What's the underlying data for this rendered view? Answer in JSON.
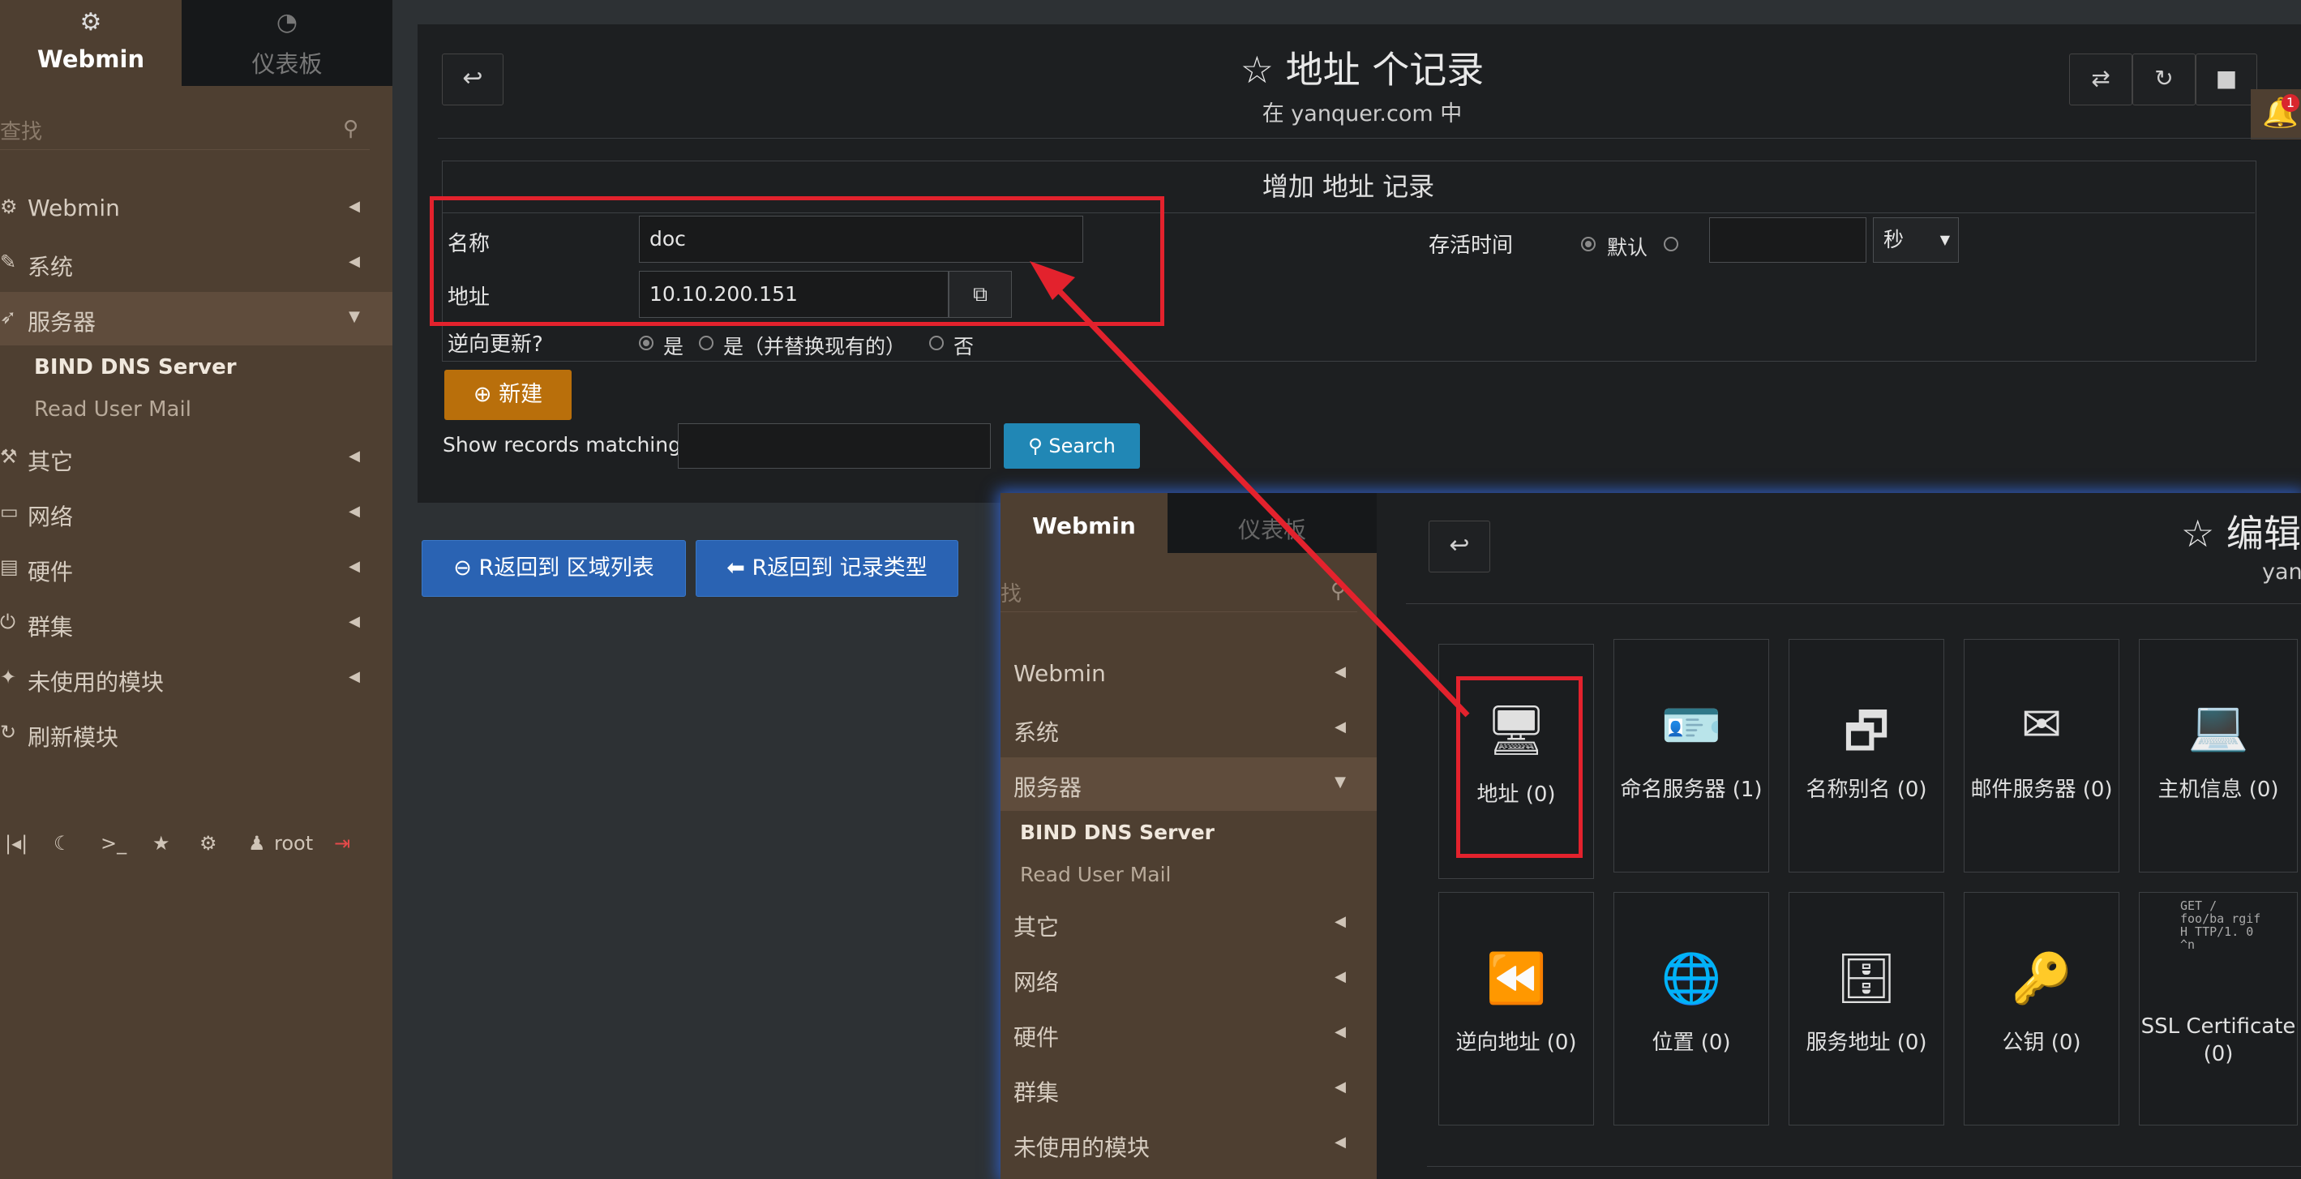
{
  "sidebar": {
    "tab_webmin": "Webmin",
    "tab_dashboard": "仪表板",
    "search_placeholder": "查找",
    "items": [
      {
        "label": "Webmin"
      },
      {
        "label": "系统"
      },
      {
        "label": "服务器"
      },
      {
        "label": "其它"
      },
      {
        "label": "网络"
      },
      {
        "label": "硬件"
      },
      {
        "label": "群集"
      },
      {
        "label": "未使用的模块"
      },
      {
        "label": "刷新模块"
      }
    ],
    "subitems": [
      {
        "label": "BIND DNS Server"
      },
      {
        "label": "Read User Mail"
      }
    ],
    "user": "root"
  },
  "header": {
    "title": "地址 个记录",
    "subtitle": "在 yanquer.com 中",
    "notification_count": "1"
  },
  "form": {
    "heading": "增加 地址 记录",
    "name_label": "名称",
    "name_value": "doc",
    "address_label": "地址",
    "address_value": "10.10.200.151",
    "ttl_label": "存活时间",
    "ttl_default": "默认",
    "ttl_unit": "秒",
    "reverse_label": "逆向更新?",
    "reverse_yes": "是",
    "reverse_replace": "是（并替换现有的）",
    "reverse_no": "否",
    "new_button": "新建",
    "show_matching_label": "Show records matching:",
    "search_button": "Search"
  },
  "back_buttons": {
    "zone_list": "R返回到 区域列表",
    "record_types": "R返回到 记录类型"
  },
  "overlay": {
    "tab_webmin": "Webmin",
    "tab_dashboard": "仪表板",
    "search_placeholder": "找",
    "items": [
      {
        "label": "Webmin"
      },
      {
        "label": "系统"
      },
      {
        "label": "服务器"
      },
      {
        "label": "其它"
      },
      {
        "label": "网络"
      },
      {
        "label": "硬件"
      },
      {
        "label": "群集"
      },
      {
        "label": "未使用的模块"
      }
    ],
    "subitems": [
      {
        "label": "BIND DNS Server"
      },
      {
        "label": "Read User Mail"
      }
    ],
    "title": "编辑",
    "subtitle": "yanq",
    "tiles": [
      {
        "label": "地址 (0)",
        "icon": "computer-icon"
      },
      {
        "label": "命名服务器 (1)",
        "icon": "id-card-icon"
      },
      {
        "label": "名称别名 (0)",
        "icon": "windows-icon"
      },
      {
        "label": "邮件服务器 (0)",
        "icon": "mail-icon"
      },
      {
        "label": "主机信息 (0)",
        "icon": "laptop-icon"
      },
      {
        "label": "逆向地址 (0)",
        "icon": "rewind-icon"
      },
      {
        "label": "位置 (0)",
        "icon": "globe-icon"
      },
      {
        "label": "服务地址 (0)",
        "icon": "server-icon"
      },
      {
        "label": "公钥 (0)",
        "icon": "key-icon"
      },
      {
        "label": "SSL Certificate (0)",
        "icon": "certificate-icon"
      }
    ],
    "ssl_snippet": "GET / foo/ba rgif H TTP/1. 0 ^n"
  },
  "colors": {
    "sidebar_bg": "#4e3f31",
    "panel_bg": "#1d1f21",
    "accent_orange": "#b96f0b",
    "accent_blue": "#2187b5",
    "annotation_red": "#e3222d"
  }
}
